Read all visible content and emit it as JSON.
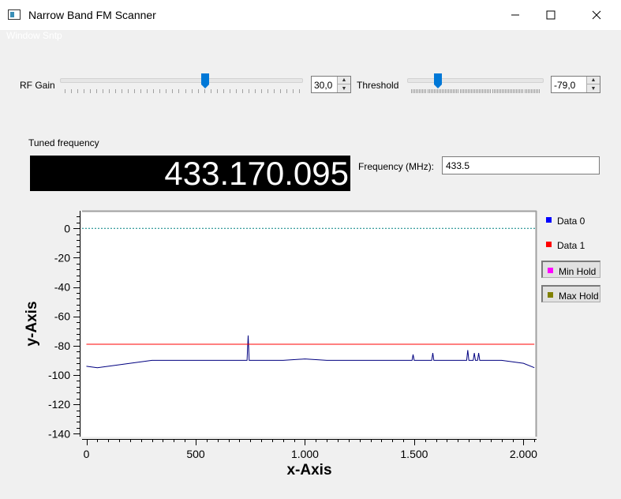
{
  "window": {
    "title": "Narrow Band FM Scanner",
    "ghost_title": "Window Sntp",
    "minimize_icon": "minimize-icon",
    "maximize_icon": "maximize-icon",
    "close_icon": "close-icon"
  },
  "controls": {
    "rf_gain_label": "RF Gain",
    "rf_gain_value": "30,0",
    "rf_gain_fraction": 0.6,
    "threshold_label": "Threshold",
    "threshold_value": "-79,0",
    "threshold_fraction": 0.21
  },
  "tuned": {
    "label": "Tuned frequency",
    "value": "433.170.095"
  },
  "frequency": {
    "label": "Frequency (MHz):",
    "value": "433.5"
  },
  "legend": [
    {
      "label": "Data 0",
      "color": "#0000ff",
      "button": false
    },
    {
      "label": "Data 1",
      "color": "#ff0000",
      "button": false
    },
    {
      "label": "Min Hold",
      "color": "#ff00ff",
      "button": true
    },
    {
      "label": "Max Hold",
      "color": "#808000",
      "button": true
    }
  ],
  "chart_data": {
    "type": "line",
    "xlabel": "x-Axis",
    "ylabel": "y-Axis",
    "xlim": [
      -20,
      2060
    ],
    "ylim": [
      -142,
      12
    ],
    "x_ticks": [
      0,
      500,
      1000,
      1500,
      2000
    ],
    "x_tick_labels": [
      "0",
      "500",
      "1.000",
      "1.500",
      "2.000"
    ],
    "y_ticks": [
      0,
      -20,
      -40,
      -60,
      -80,
      -100,
      -120,
      -140
    ],
    "y_tick_labels": [
      "0",
      "-20",
      "-40",
      "-60",
      "-80",
      "-100",
      "-120",
      "-140"
    ],
    "zero_line": {
      "value": 0,
      "color": "#008080"
    },
    "series": [
      {
        "name": "Data 0",
        "color": "#000080",
        "x": [
          0,
          50,
          100,
          150,
          200,
          250,
          300,
          400,
          500,
          600,
          700,
          735,
          740,
          745,
          750,
          800,
          900,
          1000,
          1100,
          1200,
          1300,
          1400,
          1490,
          1495,
          1500,
          1550,
          1580,
          1585,
          1590,
          1650,
          1700,
          1740,
          1745,
          1750,
          1770,
          1775,
          1780,
          1790,
          1795,
          1800,
          1850,
          1900,
          1950,
          2000,
          2050
        ],
        "y": [
          -94,
          -95,
          -94,
          -93,
          -92,
          -91,
          -90,
          -90,
          -90,
          -90,
          -90,
          -90,
          -73,
          -90,
          -90,
          -90,
          -90,
          -89,
          -90,
          -90,
          -90,
          -90,
          -90,
          -86,
          -90,
          -90,
          -90,
          -85,
          -90,
          -90,
          -90,
          -90,
          -83,
          -90,
          -90,
          -85,
          -90,
          -90,
          -85,
          -90,
          -90,
          -90,
          -91,
          -92,
          -95
        ]
      },
      {
        "name": "Data 1",
        "color": "#ff0000",
        "x": [
          0,
          2050
        ],
        "y": [
          -79,
          -79
        ]
      }
    ],
    "grid": false,
    "legend_position": "right"
  }
}
